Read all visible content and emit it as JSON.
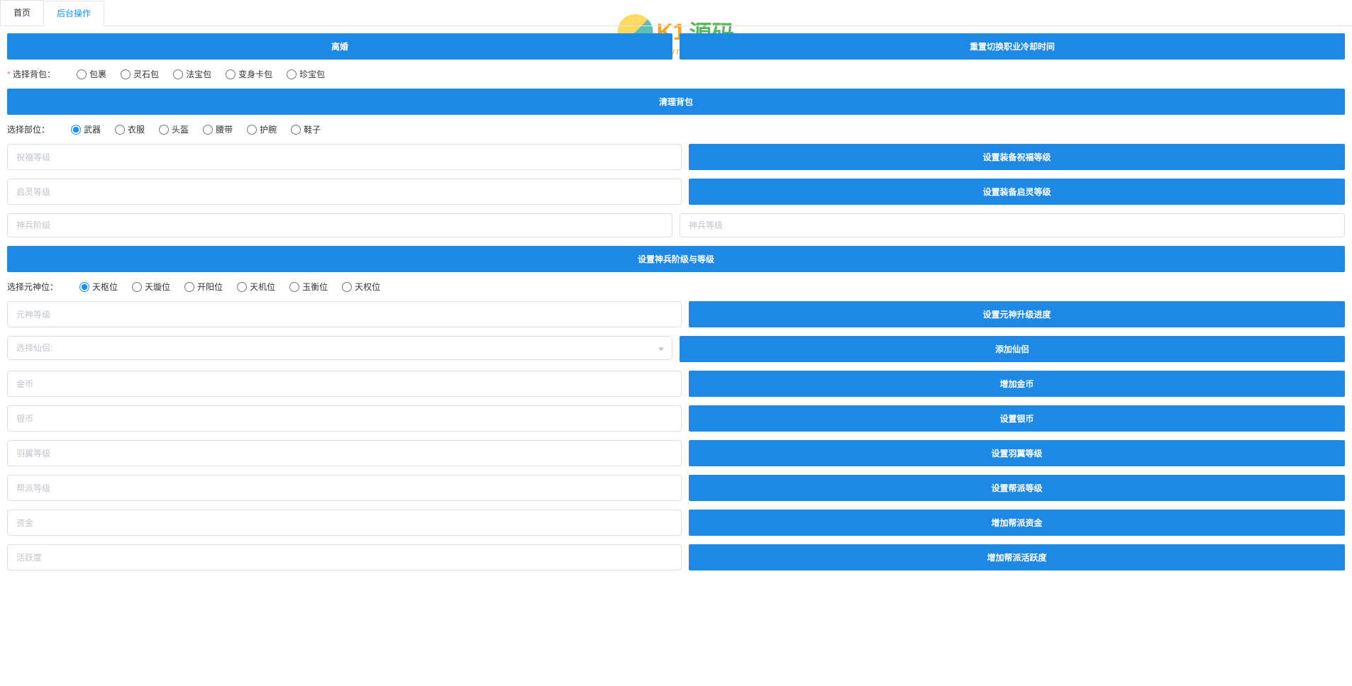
{
  "tabs": {
    "home": "首页",
    "backend": "后台操作"
  },
  "buttons": {
    "divorce": "离婚",
    "reset_job_cooldown": "重置切换职业冷却时间",
    "clear_bag": "清理背包",
    "set_shenbing": "设置神兵阶级与等级",
    "set_bless_level": "设置装备祝福等级",
    "set_qiling_level": "设置装备启灵等级",
    "set_yuanshen_progress": "设置元神升级进度",
    "add_xianlv": "添加仙侣",
    "add_gold": "增加金币",
    "set_silver": "设置银币",
    "set_wing_level": "设置羽翼等级",
    "set_gang_level": "设置帮派等级",
    "add_gang_fund": "增加帮派资金",
    "add_gang_activity": "增加帮派活跃度"
  },
  "labels": {
    "select_bag": "选择背包：",
    "select_part": "选择部位：",
    "select_yuanshen": "选择元神位："
  },
  "bag_options": [
    "包裹",
    "灵石包",
    "法宝包",
    "变身卡包",
    "珍宝包"
  ],
  "part_options": [
    "武器",
    "衣服",
    "头盔",
    "腰带",
    "护腕",
    "鞋子"
  ],
  "yuanshen_options": [
    "天枢位",
    "天璇位",
    "开阳位",
    "天机位",
    "玉衡位",
    "天权位"
  ],
  "placeholders": {
    "bless_level": "祝福等级",
    "qiling_level": "启灵等级",
    "shenbing_jieji": "神兵阶级",
    "shenbing_dengji": "神兵等级",
    "yuanshen_level": "元神等级",
    "select_xianlv": "选择仙侣:",
    "gold": "金币",
    "silver": "银币",
    "wing_level": "羽翼等级",
    "gang_level": "帮派等级",
    "fund": "资金",
    "activity": "活跃度"
  },
  "watermark": {
    "text1": "K1",
    "text2": "源码",
    "sub": "k1ym.com"
  }
}
